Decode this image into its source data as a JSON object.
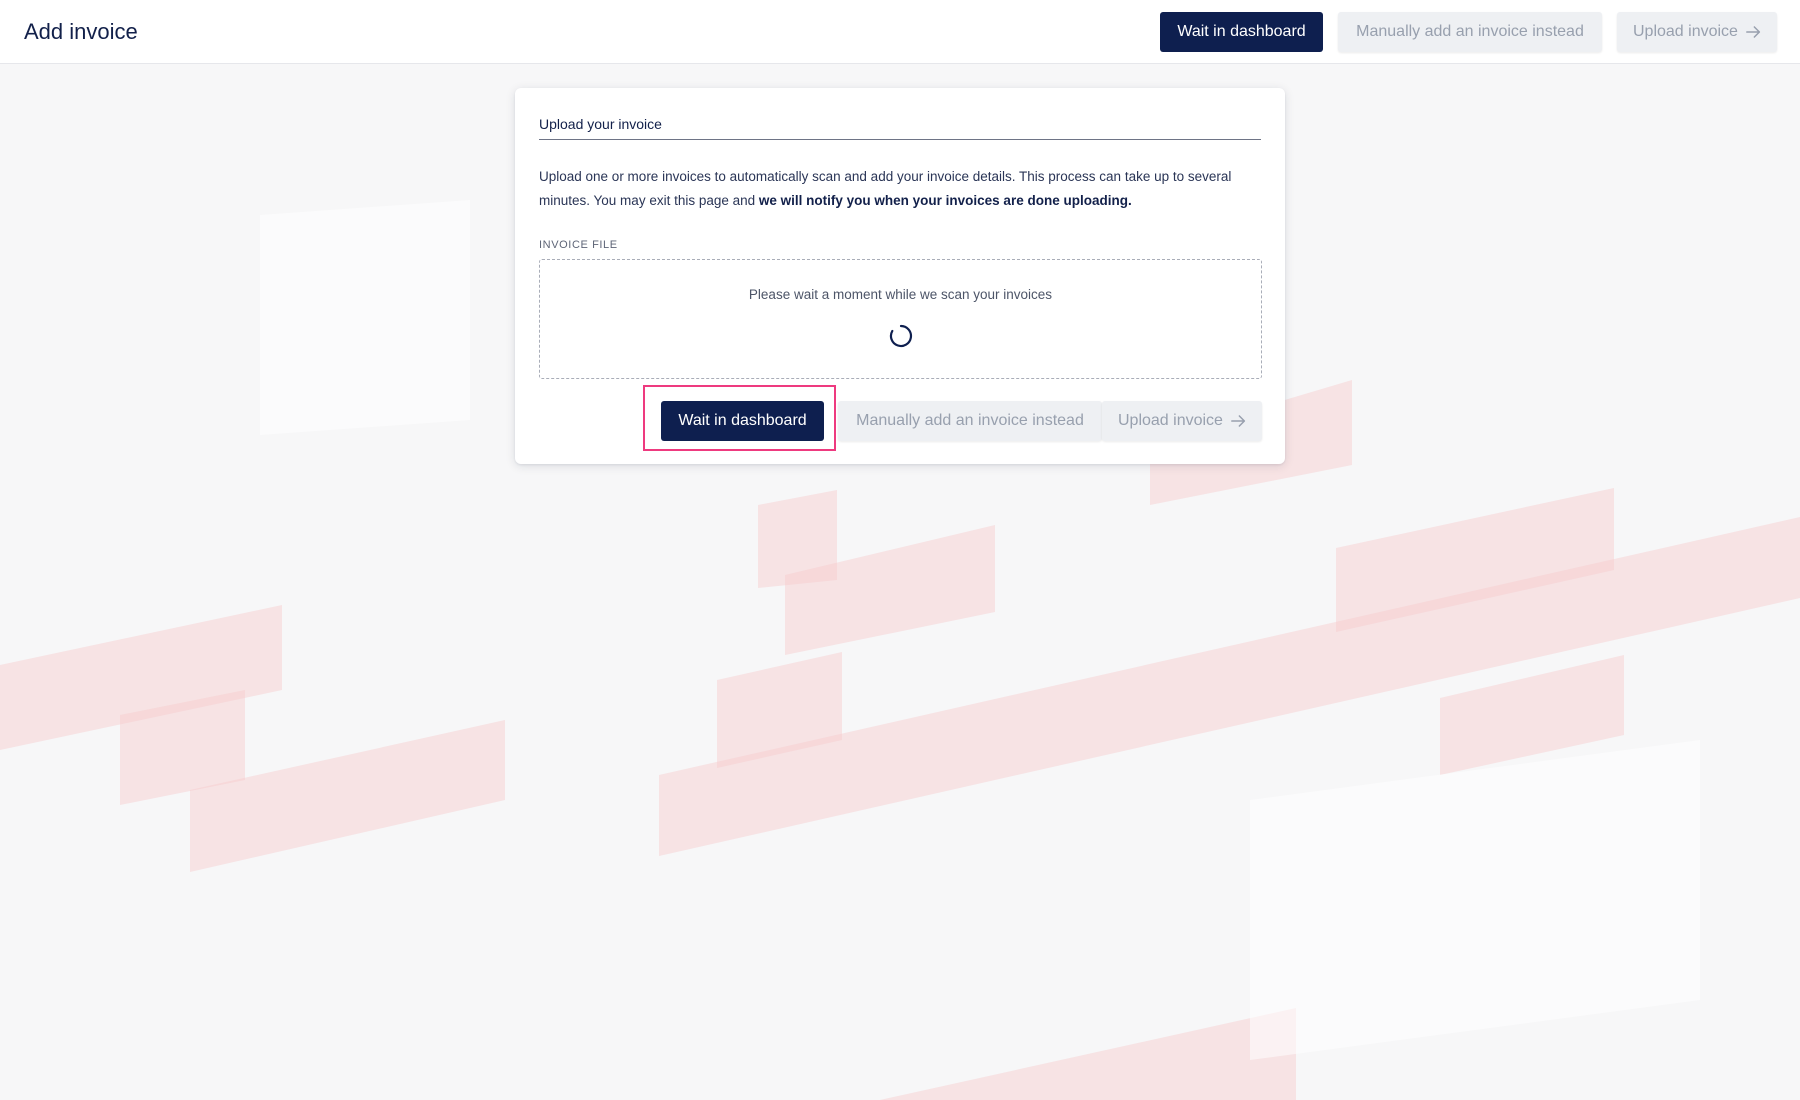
{
  "header": {
    "title": "Add invoice",
    "buttons": {
      "wait_dashboard": "Wait in dashboard",
      "manual_add": "Manually add an invoice instead",
      "upload": "Upload invoice"
    }
  },
  "card": {
    "title": "Upload your invoice",
    "description_plain": "Upload one or more invoices to automatically scan and add your invoice details. This process can take up to several minutes. You may exit this page and ",
    "description_bold": "we will notify you when your invoices are done uploading.",
    "field_label": "INVOICE FILE",
    "dropzone_status": "Please wait a moment while we scan your invoices",
    "buttons": {
      "wait_dashboard": "Wait in dashboard",
      "manual_add": "Manually add an invoice instead",
      "upload": "Upload invoice"
    }
  },
  "icons": {
    "upload_arrow": "arrow-right-icon",
    "loading": "spinner-icon"
  },
  "colors": {
    "primary": "#0e1f4f",
    "disabled_bg": "#eef0f3",
    "disabled_text": "#98a0ae",
    "highlight": "#ee3a7f",
    "background_accent": "#f6c9cc"
  }
}
